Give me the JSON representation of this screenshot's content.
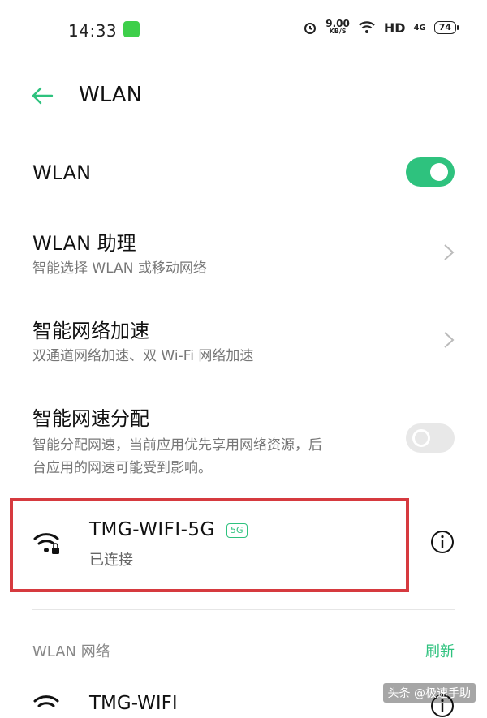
{
  "status_bar": {
    "time": "14:33",
    "speed_value": "9.00",
    "speed_unit": "KB/S",
    "hd": "HD",
    "network": "4G",
    "battery": "74"
  },
  "header": {
    "title": "WLAN"
  },
  "rows": {
    "wlan": {
      "title": "WLAN",
      "toggle": "on"
    },
    "assistant": {
      "title": "WLAN 助理",
      "subtitle": "智能选择 WLAN 或移动网络"
    },
    "accel": {
      "title": "智能网络加速",
      "subtitle": "双通道网络加速、双 Wi-Fi 网络加速"
    },
    "alloc": {
      "title": "智能网速分配",
      "subtitle_line1": "智能分配网速，当前应用优先享用网络资源，后",
      "subtitle_line2": "台应用的网速可能受到影响。",
      "toggle": "off"
    }
  },
  "connected": {
    "name": "TMG-WIFI-5G",
    "band": "5G",
    "status": "已连接"
  },
  "networks": {
    "section_title": "WLAN 网络",
    "refresh_label": "刷新",
    "items": [
      {
        "name": "TMG-WIFI"
      }
    ]
  },
  "watermark": "头条 @极速手助",
  "colors": {
    "accent": "#2ec27e",
    "highlight": "#d63a3f"
  }
}
